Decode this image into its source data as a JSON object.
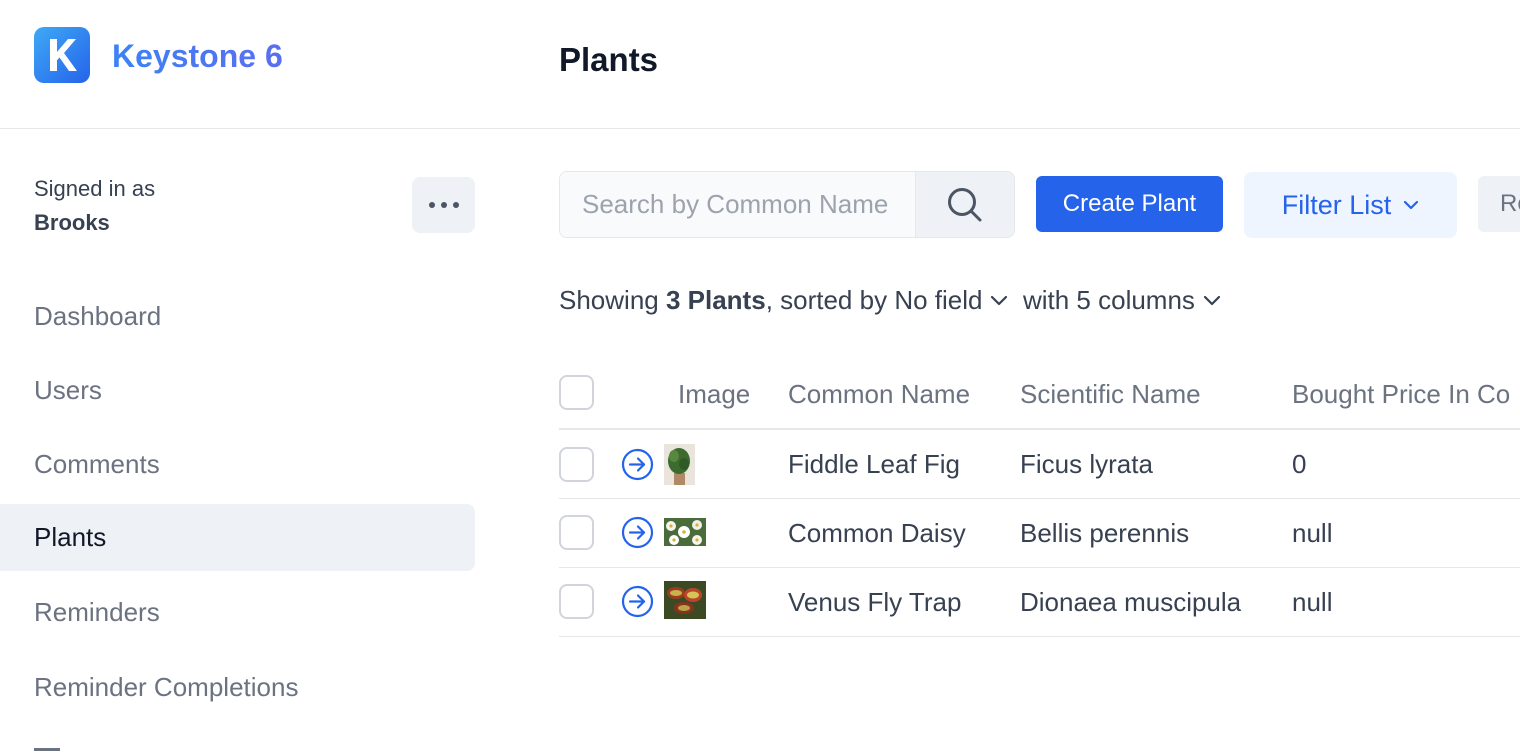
{
  "header": {
    "logo_letter": "K",
    "brand": "Keystone 6",
    "page_title": "Plants"
  },
  "sidebar": {
    "signed_in_label": "Signed in as",
    "user_name": "Brooks",
    "nav": [
      {
        "label": "Dashboard",
        "active": false
      },
      {
        "label": "Users",
        "active": false
      },
      {
        "label": "Comments",
        "active": false
      },
      {
        "label": "Plants",
        "active": true
      },
      {
        "label": "Reminders",
        "active": false
      },
      {
        "label": "Reminder Completions",
        "active": false
      }
    ]
  },
  "toolbar": {
    "search_placeholder": "Search by Common Name",
    "search_value": "",
    "create_label": "Create Plant",
    "filter_label": "Filter List",
    "reset_label": "Re"
  },
  "summary": {
    "showing": "Showing",
    "count_label": "3 Plants",
    "sorted_by": ", sorted by",
    "sort_field": "No field",
    "with": "with",
    "columns_label": "5 columns"
  },
  "table": {
    "columns": [
      "Image",
      "Common Name",
      "Scientific Name",
      "Bought Price In Co"
    ],
    "rows": [
      {
        "common_name": "Fiddle Leaf Fig",
        "scientific_name": "Ficus lyrata",
        "price": "0",
        "image": "fiddle-leaf-fig-photo"
      },
      {
        "common_name": "Common Daisy",
        "scientific_name": "Bellis perennis",
        "price": "null",
        "image": "common-daisy-photo"
      },
      {
        "common_name": "Venus Fly Trap",
        "scientific_name": "Dionaea muscipula",
        "price": "null",
        "image": "venus-fly-trap-photo"
      }
    ]
  },
  "colors": {
    "accent": "#2563eb",
    "brand_gradient_start": "#3fa9f5",
    "active_nav_bg": "#eef1f5"
  }
}
